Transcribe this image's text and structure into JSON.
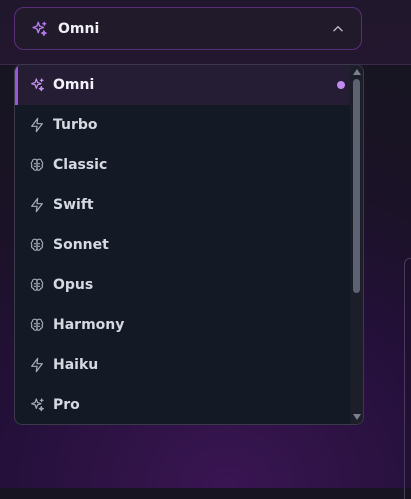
{
  "selector": {
    "value": "Omni",
    "icon": "sparkles-icon",
    "expanded_icon": "chevron-up-icon"
  },
  "menu": {
    "items": [
      {
        "label": "Omni",
        "icon": "sparkles-icon",
        "selected": true
      },
      {
        "label": "Turbo",
        "icon": "lightning-icon"
      },
      {
        "label": "Classic",
        "icon": "brain-icon"
      },
      {
        "label": "Swift",
        "icon": "lightning-icon"
      },
      {
        "label": "Sonnet",
        "icon": "brain-icon"
      },
      {
        "label": "Opus",
        "icon": "brain-icon"
      },
      {
        "label": "Harmony",
        "icon": "brain-icon"
      },
      {
        "label": "Haiku",
        "icon": "lightning-icon"
      },
      {
        "label": "Pro",
        "icon": "sparkles-icon"
      }
    ]
  },
  "colors": {
    "accent": "#9b59d9",
    "selected_dot": "#c08af0",
    "menu_bg": "#131a26",
    "trigger_border": "#5a2f7a"
  }
}
